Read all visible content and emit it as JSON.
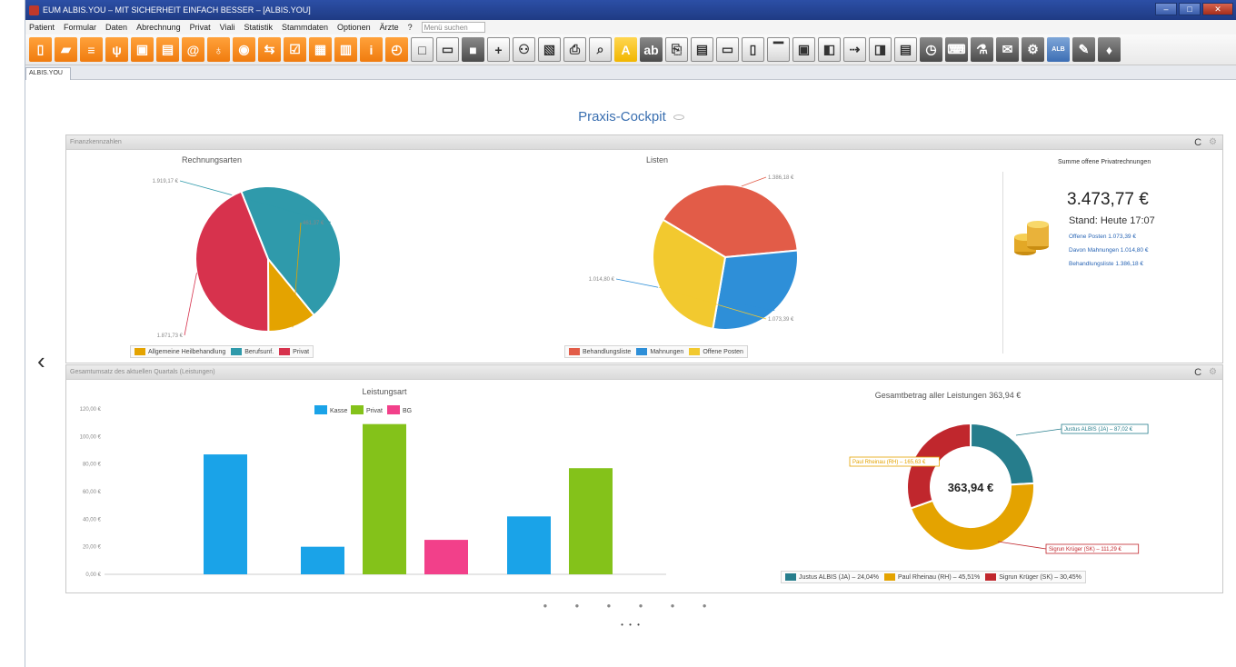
{
  "window": {
    "title": "EUM ALBIS.YOU – MIT SICHERHEIT EINFACH BESSER – [ALBIS.YOU]"
  },
  "menu": {
    "items": [
      "Patient",
      "Formular",
      "Daten",
      "Abrechnung",
      "Privat",
      "Viali",
      "Statistik",
      "Stammdaten",
      "Optionen",
      "Ärzte",
      "?"
    ],
    "search_placeholder": "Menü suchen"
  },
  "tab": {
    "label": "ALBIS.YOU"
  },
  "page": {
    "title": "Praxis-Cockpit",
    "prev_arrow": "‹",
    "dots": "● ● ● ● ● ●",
    "more": "• • •"
  },
  "panel_top": {
    "header": "Finanzkennzahlen",
    "refresh": "C",
    "gear": "⚙",
    "pie1": {
      "title": "Rechnungsarten",
      "legend": [
        "Allgemeine Heilbehandlung",
        "Berufsunf.",
        "Privat"
      ],
      "labels": [
        "1.919,17 €",
        "461,37 €",
        "1.871,73 €"
      ]
    },
    "pie2": {
      "title": "Listen",
      "legend": [
        "Behandlungsliste",
        "Mahnungen",
        "Offene Posten"
      ],
      "labels": [
        "1.386,18 €",
        "1.014,80 €",
        "1.073,39 €"
      ]
    },
    "summary": {
      "label": "Summe offene Privatrechnungen",
      "total": "3.473,77 €",
      "stand": "Stand: Heute 17:07",
      "links": [
        "Offene Posten 1.073,39 €",
        "Davon Mahnungen 1.014,80 €",
        "Behandlungsliste 1.386,18 €"
      ]
    }
  },
  "panel_bottom": {
    "header": "Gesamtumsatz des aktuellen Quartals (Leistungen)",
    "refresh": "C",
    "gear": "⚙",
    "bar_title": "Leistungsart",
    "donut_title": "Gesamtbetrag aller Leistungen 363,94 €",
    "donut_center": "363,94 €",
    "donut_callouts": [
      "Justus ALBIS (JA) – 87,02 €",
      "Paul Rheinau (RH) – 165,63 €",
      "Sigrun Krüger (SK) – 111,29 €"
    ],
    "donut_legend": [
      "Justus ALBIS (JA) – 24,04%",
      "Paul Rheinau (RH) – 45,51%",
      "Sigrun Krüger (SK) – 30,45%"
    ]
  },
  "chart_data": [
    {
      "type": "pie",
      "title": "Rechnungsarten",
      "categories": [
        "Allgemeine Heilbehandlung",
        "Berufsunf.",
        "Privat"
      ],
      "values": [
        1919.17,
        461.37,
        1871.73
      ],
      "colors": [
        "#2f9aab",
        "#e4a300",
        "#d7324d"
      ]
    },
    {
      "type": "pie",
      "title": "Listen",
      "categories": [
        "Behandlungsliste",
        "Mahnungen",
        "Offene Posten"
      ],
      "values": [
        1386.18,
        1014.8,
        1073.39
      ],
      "colors": [
        "#e25c48",
        "#2e8fd8",
        "#f2c92f"
      ]
    },
    {
      "type": "bar",
      "title": "Leistungsart",
      "categories": [
        "Justus ALBIS (JA)",
        "Paul Rheinau (RH)",
        "Sigrun Krüger (SK)"
      ],
      "series": [
        {
          "name": "Kasse",
          "values": [
            87,
            20,
            42
          ],
          "color": "#1aa3e8"
        },
        {
          "name": "Privat",
          "values": [
            0,
            109,
            77
          ],
          "color": "#84c21a"
        },
        {
          "name": "BG",
          "values": [
            0,
            25,
            0
          ],
          "color": "#f2408a"
        }
      ],
      "yticks": [
        "0,00 €",
        "20,00 €",
        "40,00 €",
        "60,00 €",
        "80,00 €",
        "100,00 €",
        "120,00 €"
      ],
      "ylim": [
        0,
        120
      ]
    },
    {
      "type": "pie",
      "title": "Gesamtbetrag aller Leistungen 363,94 €",
      "categories": [
        "Justus ALBIS (JA)",
        "Paul Rheinau (RH)",
        "Sigrun Krüger (SK)"
      ],
      "values": [
        87.48,
        165.63,
        110.83
      ],
      "colors": [
        "#267d8c",
        "#e4a300",
        "#c0272d"
      ]
    }
  ],
  "colors": {
    "accent": "#3a6fb0",
    "toolbar_orange": "#f07c0f"
  }
}
